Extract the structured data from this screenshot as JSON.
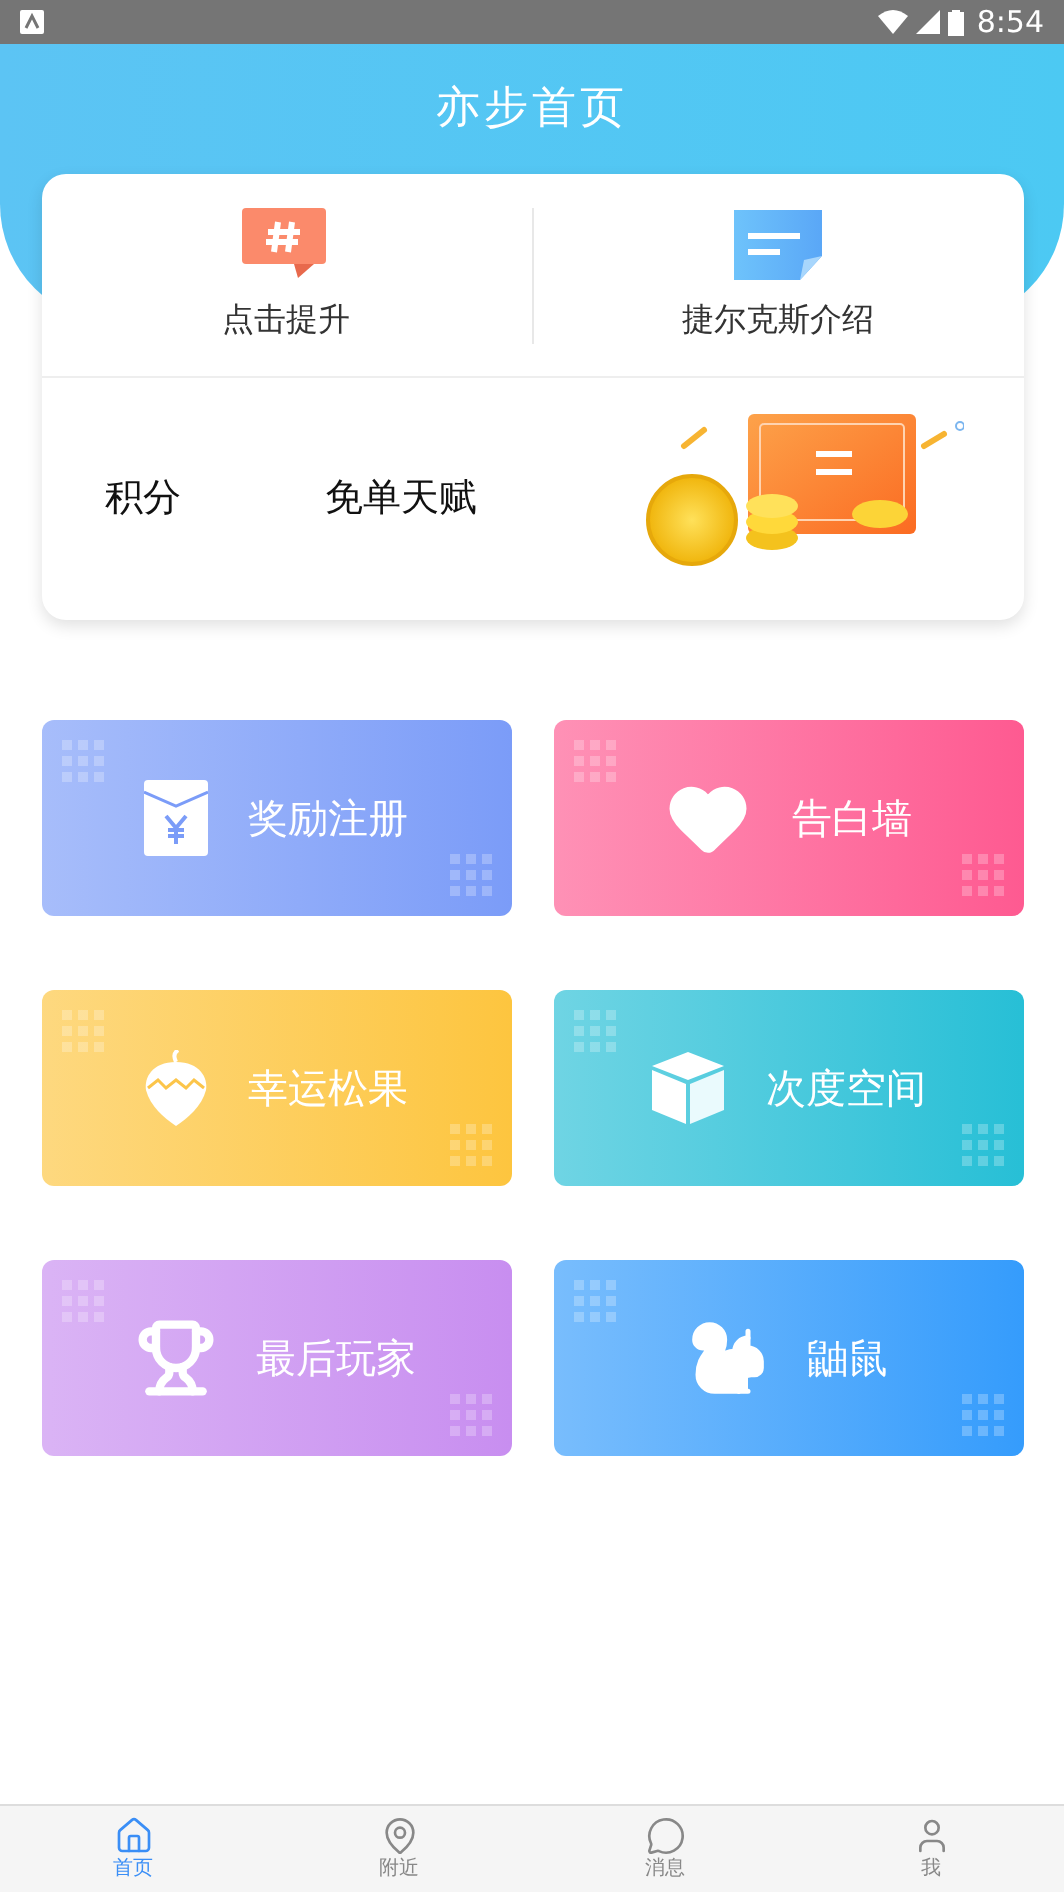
{
  "status_bar": {
    "time": "8:54"
  },
  "header": {
    "title": "亦步首页"
  },
  "quick_links": [
    {
      "kind": "hashtag",
      "label": "点击提升"
    },
    {
      "kind": "note",
      "label": "捷尔克斯介绍"
    }
  ],
  "stats": [
    {
      "label": "积分"
    },
    {
      "label": "免单天赋"
    }
  ],
  "tiles": [
    {
      "kind": "envelope",
      "label": "奖励注册",
      "color": "#7b9cf8"
    },
    {
      "kind": "heart",
      "label": "告白墙",
      "color": "#fe5a91"
    },
    {
      "kind": "acorn",
      "label": "幸运松果",
      "color": "#fdc53f"
    },
    {
      "kind": "cube",
      "label": "次度空间",
      "color": "#27bfd6"
    },
    {
      "kind": "trophy",
      "label": "最后玩家",
      "color": "#c88ef0"
    },
    {
      "kind": "squirrel",
      "label": "鼬鼠",
      "color": "#359cfc"
    }
  ],
  "bottom_nav": [
    {
      "kind": "home",
      "label": "首页",
      "selected": true
    },
    {
      "kind": "pin",
      "label": "附近",
      "selected": false
    },
    {
      "kind": "chat",
      "label": "消息",
      "selected": false
    },
    {
      "kind": "user",
      "label": "我",
      "selected": false
    }
  ]
}
